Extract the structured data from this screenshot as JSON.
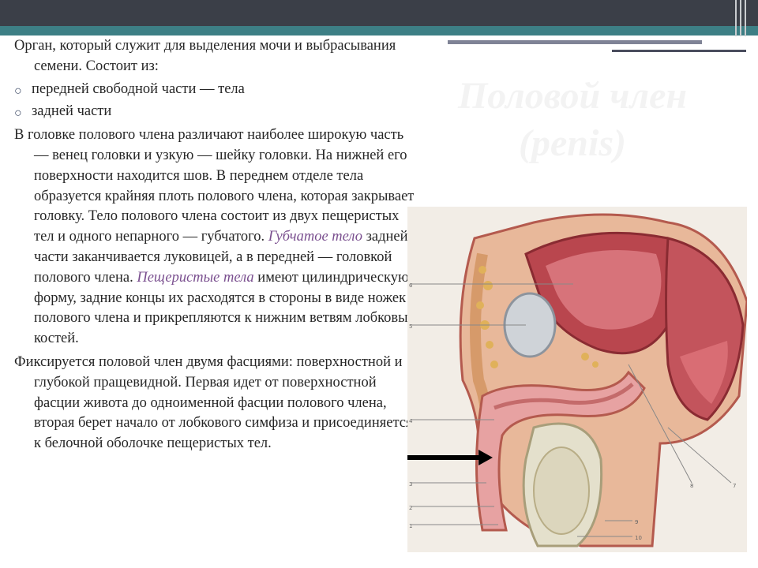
{
  "slide": {
    "title": "Половой член (penis)",
    "accent_colors": {
      "dark_bar": "#3b3f48",
      "teal_bar": "#3d7f85",
      "term": "#7a4f8f"
    },
    "paragraphs": [
      {
        "id": "p1",
        "text": "Орган, который служит для выделения мочи и выбрасывания семени. Состоит из:"
      },
      {
        "id": "p2",
        "parts": [
          {
            "text": "В головке полового члена различают наиболее широкую часть — венец головки и узкую — шейку головки. На нижней его поверхности находится шов. В переднем отделе тела образуется крайняя плоть полового члена, которая закрывает головку. Тело полового члена состоит из двух пещеристых тел и одного непарного — губчатого. "
          },
          {
            "text": "Губчатое тело",
            "term": true
          },
          {
            "text": " задней части заканчивается луковицей, а в передней — головкой полового члена. "
          },
          {
            "text": "Пещеристые тела",
            "term": true
          },
          {
            "text": " имеют цилиндрическую форму, задние концы их расходятся в стороны в виде ножек полового члена и прикрепляются к нижним ветвям лобковых костей."
          }
        ]
      },
      {
        "id": "p3",
        "text": "Фиксируется половой член двумя фасциями: поверхностной и глубокой пращевидной. Первая идет от поверхностной фасции живота до одноименной фасции полового члена, вторая берет начало от лобкового симфиза и присоединяется к белочной оболочке пещеристых тел."
      }
    ],
    "bullets": [
      {
        "mark": "○",
        "text": "передней свободной части — тела"
      },
      {
        "mark": "○",
        "text": "задней части"
      }
    ],
    "figure": {
      "description_icon": "anatomical-illustration",
      "labels": [
        "6",
        "5",
        "4",
        "3",
        "2",
        "1",
        "7",
        "8",
        "9",
        "10"
      ]
    }
  }
}
